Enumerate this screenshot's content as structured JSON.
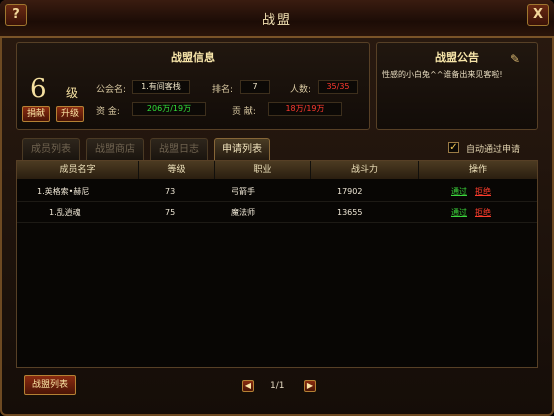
{
  "window": {
    "title": "战盟",
    "help": "?",
    "close": "X"
  },
  "info": {
    "title": "战盟信息",
    "level": "6",
    "level_unit": "级",
    "donate_btn": "捐献",
    "upgrade_btn": "升级",
    "guild_name_label": "公会名:",
    "guild_name": "1.有间客栈",
    "rank_label": "排名:",
    "rank": "7",
    "members_label": "人数:",
    "members": "35/35",
    "funds_label": "资  金:",
    "funds": "206万/19万",
    "contribution_label": "贡  献:",
    "contribution": "18万/19万"
  },
  "notice": {
    "title": "战盟公告",
    "text": "性感的小白兔^^谁备出来见客啦!"
  },
  "tabs": [
    "成员列表",
    "战盟商店",
    "战盟日志",
    "申请列表"
  ],
  "auto_approve": {
    "label": "自动通过申请",
    "checked": "✓"
  },
  "table": {
    "columns": [
      "成员名字",
      "等级",
      "职业",
      "战斗力",
      "操作"
    ],
    "rows": [
      {
        "name": "1.英格索•赫尼",
        "level": "73",
        "class": "弓箭手",
        "power": "17902",
        "accept": "通过",
        "reject": "拒绝"
      },
      {
        "name": "1.乱逍魂",
        "level": "75",
        "class": "魔法师",
        "power": "13655",
        "accept": "通过",
        "reject": "拒绝"
      }
    ]
  },
  "footer": {
    "union_list_btn": "战盟列表",
    "prev": "◀",
    "next": "▶",
    "page": "1/1"
  },
  "colors": {
    "accept": "#3bd63b",
    "reject": "#ff3d2d",
    "gold": "#f5e0a0"
  }
}
